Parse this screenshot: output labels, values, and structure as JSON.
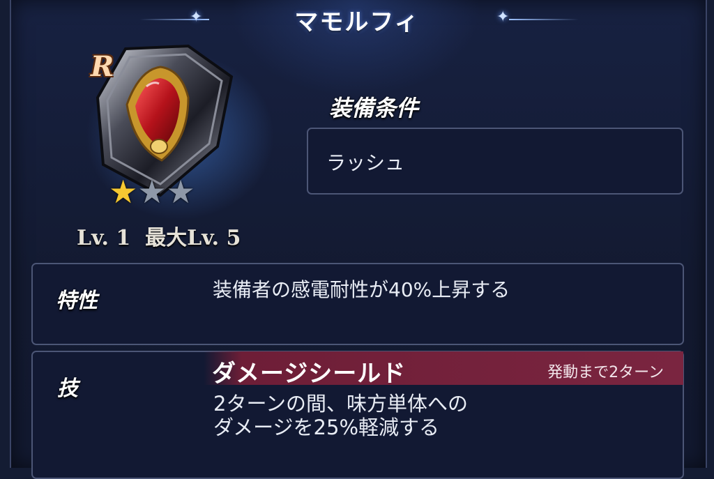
{
  "header": {
    "title": "マモルフィ"
  },
  "item": {
    "rarity": "R",
    "stars_filled": 1,
    "stars_total": 3,
    "level_text": "Lv. 1  最大Lv. 5"
  },
  "equip": {
    "heading": "装備条件",
    "value": "ラッシュ"
  },
  "trait": {
    "label": "特性",
    "text": "装備者の感電耐性が40%上昇する"
  },
  "skill": {
    "label": "技",
    "name": "ダメージシールド",
    "cooldown": "発動まで2ターン",
    "desc_line1": "2ターンの間、味方単体への",
    "desc_line2": "ダメージを25%軽減する"
  },
  "colors": {
    "skill_bar": "#7a2540",
    "star_on": "#f5c832",
    "star_off": "#8e98a8"
  },
  "icons": [
    "shield-item-icon",
    "star-icon",
    "sparkle-icon"
  ]
}
